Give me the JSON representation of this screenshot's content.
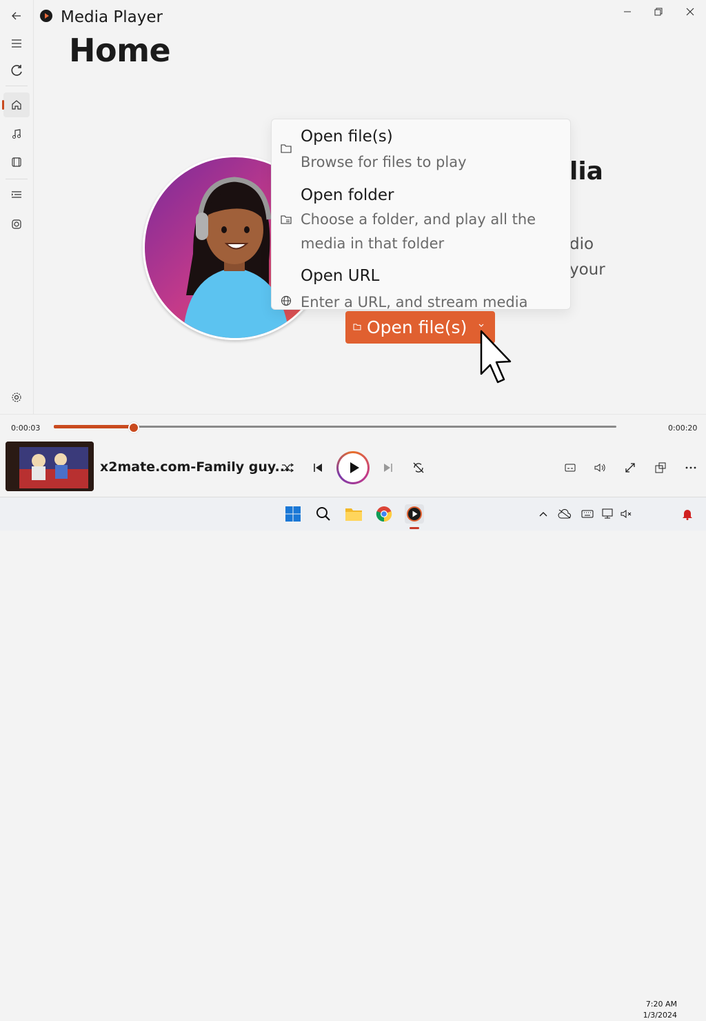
{
  "window": {
    "title": "Media Player"
  },
  "page": {
    "title": "Home"
  },
  "background": {
    "heading_partial": "lia",
    "sub_partial_1": "dio",
    "sub_partial_2": "your"
  },
  "menu": {
    "items": [
      {
        "title": "Open file(s)",
        "description": "Browse for files to play",
        "icon": "folder-icon"
      },
      {
        "title": "Open folder",
        "description": "Choose a folder, and play all the media in that folder",
        "icon": "folder-list-icon"
      },
      {
        "title": "Open URL",
        "description": "Enter a URL, and stream media",
        "icon": "globe-icon"
      }
    ]
  },
  "open_button": {
    "label": "Open file(s)"
  },
  "player": {
    "elapsed": "0:00:03",
    "duration": "0:00:20",
    "progress": 0.14,
    "track_name": "x2mate.com-Family guy..."
  },
  "taskbar": {
    "time": "7:20 AM",
    "date": "1/3/2024"
  },
  "colors": {
    "accent": "#e06030",
    "progress": "#c94a1e"
  }
}
